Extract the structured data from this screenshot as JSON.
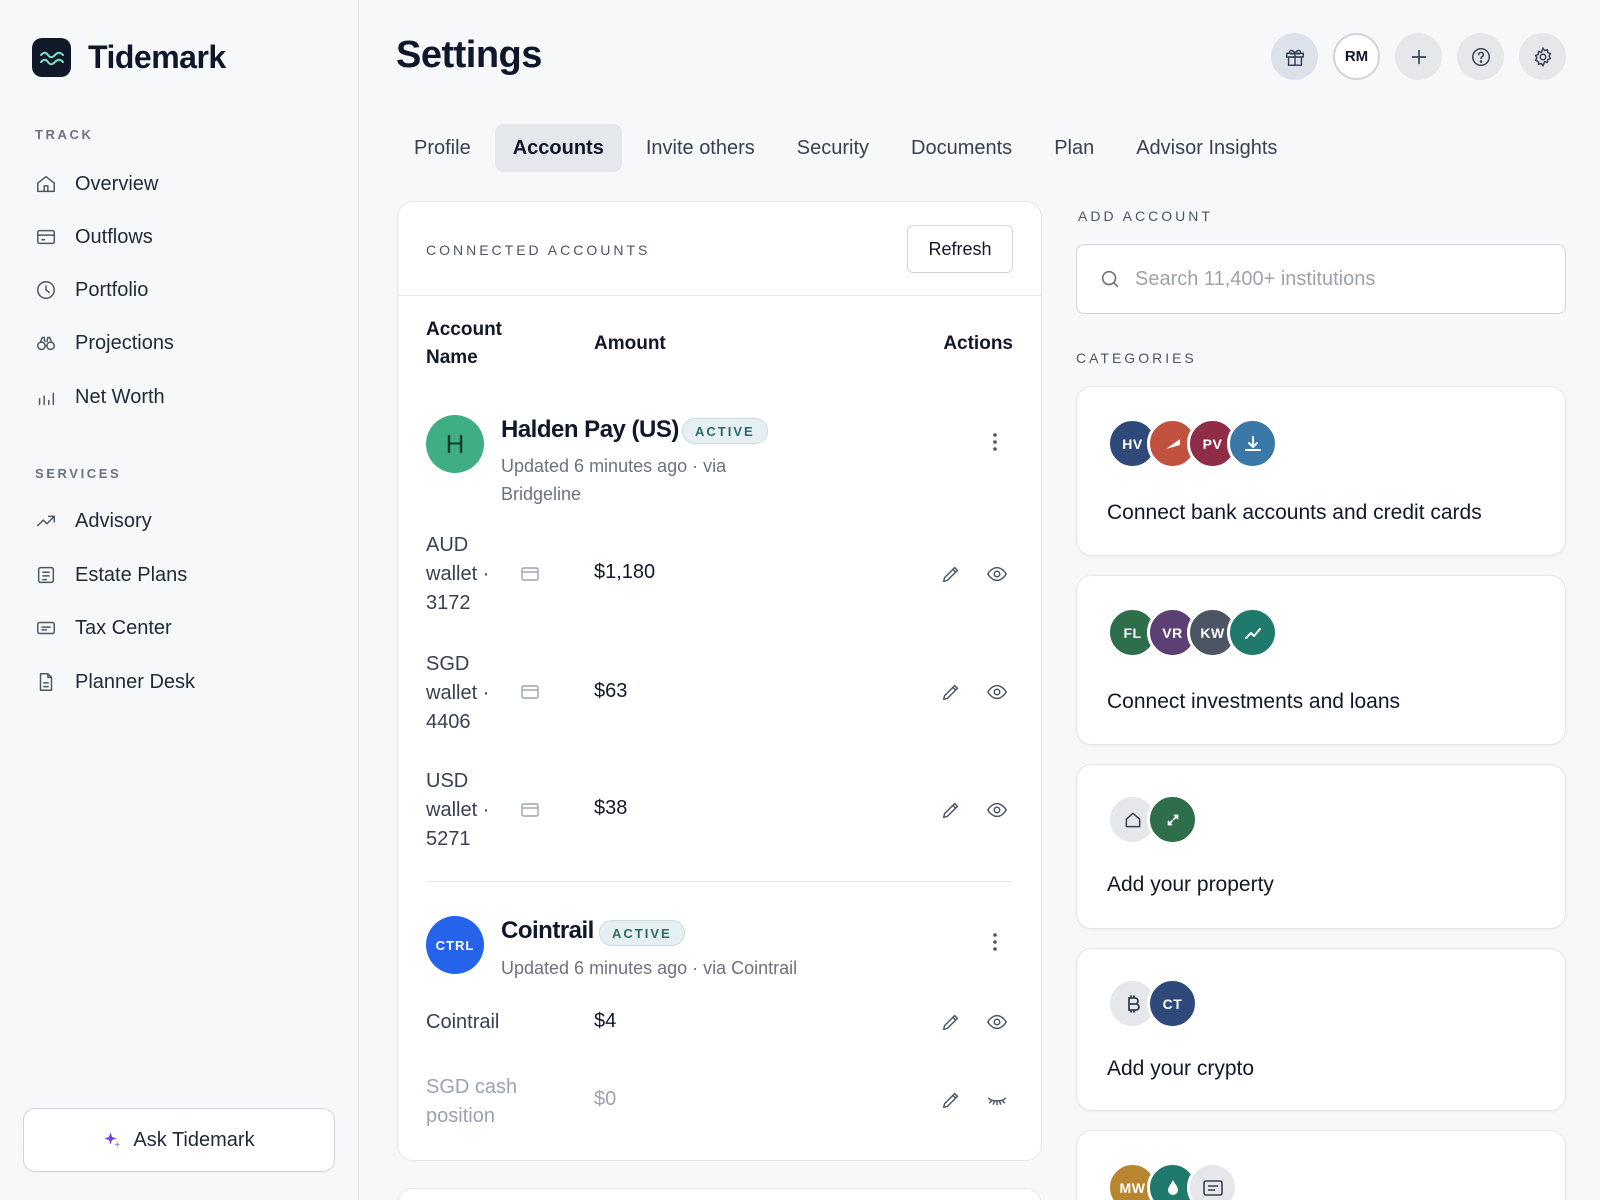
{
  "app": {
    "name": "Tidemark"
  },
  "sidebar": {
    "sections": [
      {
        "label": "TRACK",
        "items": [
          {
            "label": "Overview",
            "icon": "home-icon"
          },
          {
            "label": "Outflows",
            "icon": "card-icon"
          },
          {
            "label": "Portfolio",
            "icon": "pie-clock-icon"
          },
          {
            "label": "Projections",
            "icon": "binoculars-icon"
          },
          {
            "label": "Net Worth",
            "icon": "bar-chart-icon"
          }
        ]
      },
      {
        "label": "SERVICES",
        "items": [
          {
            "label": "Advisory",
            "icon": "trend-up-icon"
          },
          {
            "label": "Estate Plans",
            "icon": "document-list-icon"
          },
          {
            "label": "Tax Center",
            "icon": "receipt-icon"
          },
          {
            "label": "Planner Desk",
            "icon": "file-icon"
          }
        ]
      }
    ],
    "ask_label": "Ask Tidemark"
  },
  "header": {
    "title": "Settings",
    "avatar_initials": "RM",
    "actions": [
      "gift-icon",
      "avatar",
      "plus-icon",
      "help-icon",
      "gear-icon"
    ]
  },
  "tabs": [
    {
      "label": "Profile",
      "active": false
    },
    {
      "label": "Accounts",
      "active": true
    },
    {
      "label": "Invite others",
      "active": false
    },
    {
      "label": "Security",
      "active": false
    },
    {
      "label": "Documents",
      "active": false
    },
    {
      "label": "Plan",
      "active": false
    },
    {
      "label": "Advisor Insights",
      "active": false
    }
  ],
  "connected": {
    "label": "CONNECTED ACCOUNTS",
    "refresh_label": "Refresh",
    "columns": {
      "name": "Account Name",
      "amount": "Amount",
      "actions": "Actions"
    },
    "institutions": [
      {
        "initials": "H",
        "name": "Halden Pay (US)",
        "status": "ACTIVE",
        "subtitle": "Updated 6 minutes ago · via Bridgeline",
        "color": "#3fae83",
        "accounts": [
          {
            "name": "AUD wallet · 3172",
            "amount": "$1,180",
            "hidden": false
          },
          {
            "name": "SGD wallet · 4406",
            "amount": "$63",
            "hidden": false
          },
          {
            "name": "USD wallet · 5271",
            "amount": "$38",
            "hidden": false
          }
        ]
      },
      {
        "initials": "CTRL",
        "name": "Cointrail",
        "status": "ACTIVE",
        "subtitle": "Updated 6 minutes ago · via Cointrail",
        "color": "#2563eb",
        "accounts": [
          {
            "name": "Cointrail",
            "amount": "$4",
            "hidden": false
          },
          {
            "name": "SGD cash position",
            "amount": "$0",
            "hidden": true
          }
        ]
      }
    ]
  },
  "add_account": {
    "label": "ADD ACCOUNT",
    "search_placeholder": "Search 11,400+ institutions",
    "categories_label": "CATEGORIES",
    "categories": [
      {
        "text": "Connect bank accounts and credit cards",
        "logos": [
          {
            "text": "HV",
            "color": "#2f4a7a"
          },
          {
            "text": "",
            "icon": "flag-icon",
            "color": "#c0523f"
          },
          {
            "text": "PV",
            "color": "#8f2d46"
          },
          {
            "text": "",
            "icon": "download-icon",
            "color": "#3a78a8"
          }
        ]
      },
      {
        "text": "Connect investments and loans",
        "logos": [
          {
            "text": "FL",
            "color": "#2f6e4a"
          },
          {
            "text": "VR",
            "color": "#5c3f73"
          },
          {
            "text": "KW",
            "color": "#4b5563"
          },
          {
            "text": "",
            "icon": "trend-icon",
            "color": "#1f7a6b"
          }
        ]
      },
      {
        "text": "Add your property",
        "logos": [
          {
            "text": "",
            "icon": "house-icon",
            "color": "#e5e7eb"
          },
          {
            "text": "",
            "icon": "arrows-icon",
            "color": "#2f6e4a"
          }
        ]
      },
      {
        "text": "Add your crypto",
        "logos": [
          {
            "text": "",
            "icon": "bitcoin-icon",
            "color": "#e5e7eb"
          },
          {
            "text": "CT",
            "color": "#2f4a7a"
          }
        ]
      },
      {
        "text": "",
        "logos": [
          {
            "text": "MW",
            "color": "#b7862f"
          },
          {
            "text": "",
            "icon": "drop-icon",
            "color": "#1f7a6b"
          },
          {
            "text": "",
            "icon": "note-icon",
            "color": "#e5e7eb"
          }
        ]
      }
    ]
  }
}
